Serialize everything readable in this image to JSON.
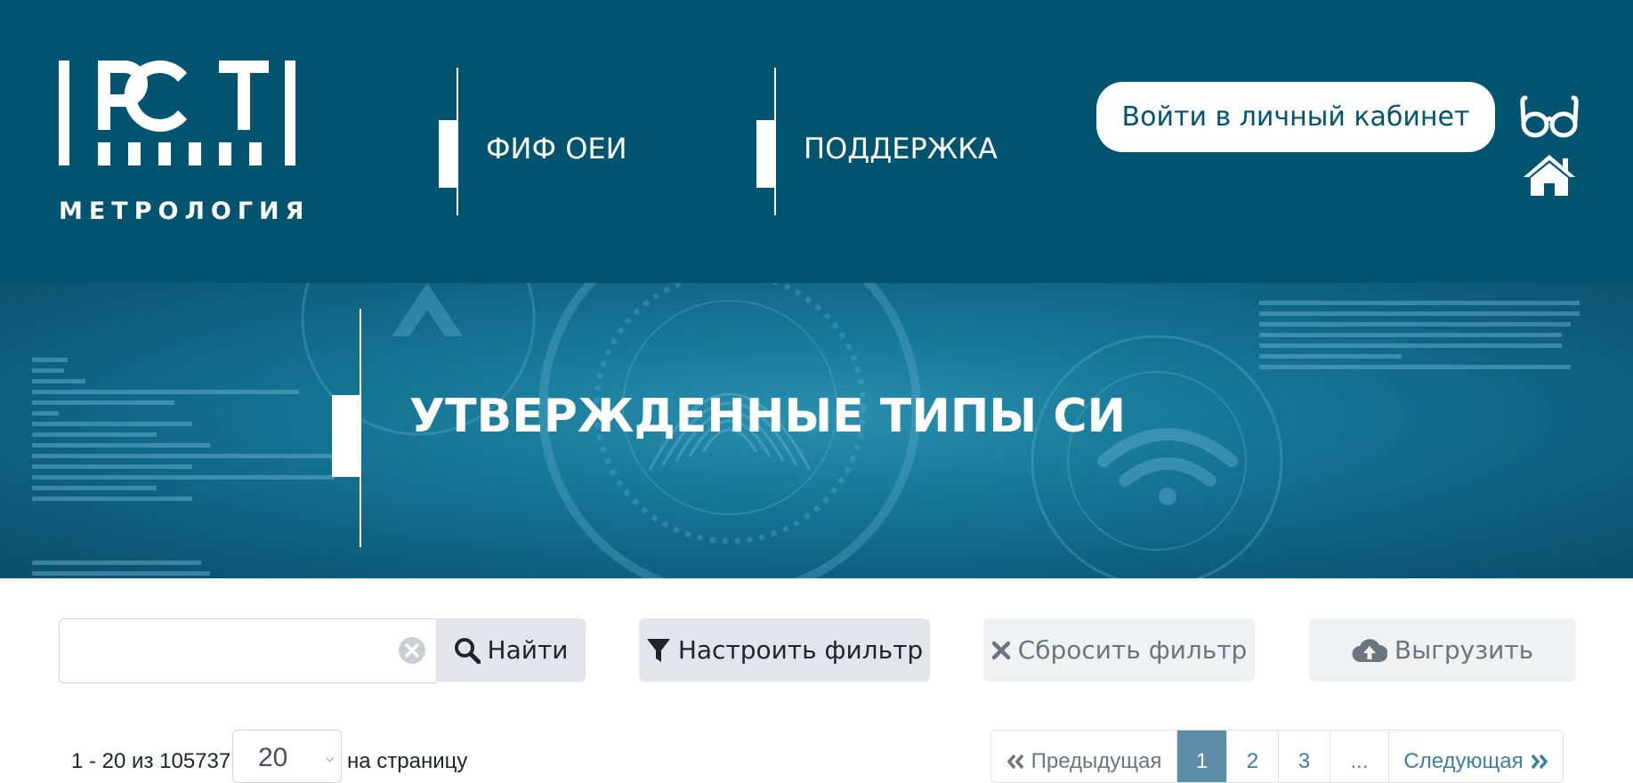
{
  "header": {
    "logo_text": "МЕТРОЛОГИЯ",
    "logo_mark": "РСТ",
    "nav": [
      {
        "label": "ФИФ ОЕИ"
      },
      {
        "label": "ПОДДЕРЖКА"
      }
    ],
    "login_label": "Войти в личный кабинет",
    "icons": [
      "glasses-icon",
      "home-icon"
    ]
  },
  "banner": {
    "title": "УТВЕРЖДЕННЫЕ ТИПЫ СИ"
  },
  "toolbar": {
    "search_value": "",
    "search_placeholder": "",
    "find_label": "Найти",
    "filter_label": "Настроить фильтр",
    "reset_label": "Сбросить фильтр",
    "export_label": "Выгрузить"
  },
  "pager": {
    "range_text": "1 - 20 из 105737",
    "per_page_value": "20",
    "per_page_label": "на страницу",
    "prev_label": "Предыдущая",
    "pages": [
      "1",
      "2",
      "3"
    ],
    "current_page": "1",
    "ellipsis": "...",
    "next_label": "Следующая"
  },
  "colors": {
    "header_bg": "#01546f",
    "accent": "#01546f",
    "active_page": "#5b8ea6",
    "button_bg": "#e2e6ea",
    "button_disabled_bg": "#eff1f3"
  }
}
